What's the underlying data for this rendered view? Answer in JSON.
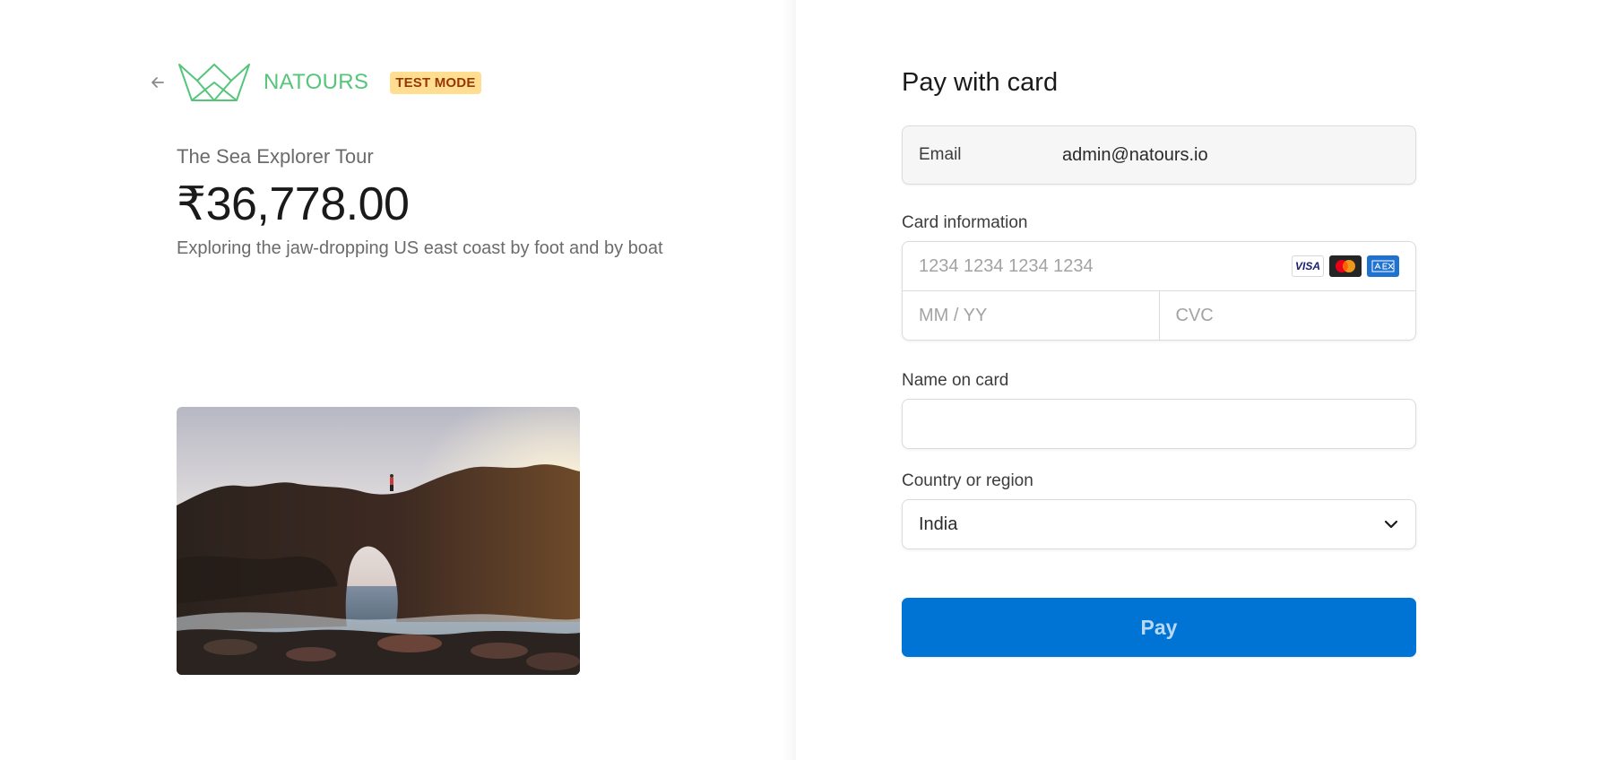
{
  "header": {
    "back_icon": "arrow-left-icon",
    "logo_icon": "crown-logo-icon",
    "brand_name": "NATOURS",
    "test_mode_badge": "TEST MODE"
  },
  "product": {
    "name": "The Sea Explorer Tour",
    "price": "₹36,778.00",
    "description": "Exploring the jaw-dropping US east coast by foot and by boat",
    "image_icon": "tour-photo"
  },
  "payment": {
    "title": "Pay with card",
    "email_label": "Email",
    "email_value": "admin@natours.io",
    "card_info_label": "Card information",
    "card_number_placeholder": "1234 1234 1234 1234",
    "expiry_placeholder": "MM / YY",
    "cvc_placeholder": "CVC",
    "card_brands": [
      "VISA",
      "mastercard-icon",
      "amex-icon"
    ],
    "name_label": "Name on card",
    "name_value": "",
    "country_label": "Country or region",
    "country_value": "India",
    "country_icon": "chevron-down-icon",
    "pay_button": "Pay"
  },
  "colors": {
    "brand_green": "#55c57a",
    "badge_bg": "#ffde92",
    "badge_text": "#983705",
    "pay_button": "#0074d4"
  }
}
